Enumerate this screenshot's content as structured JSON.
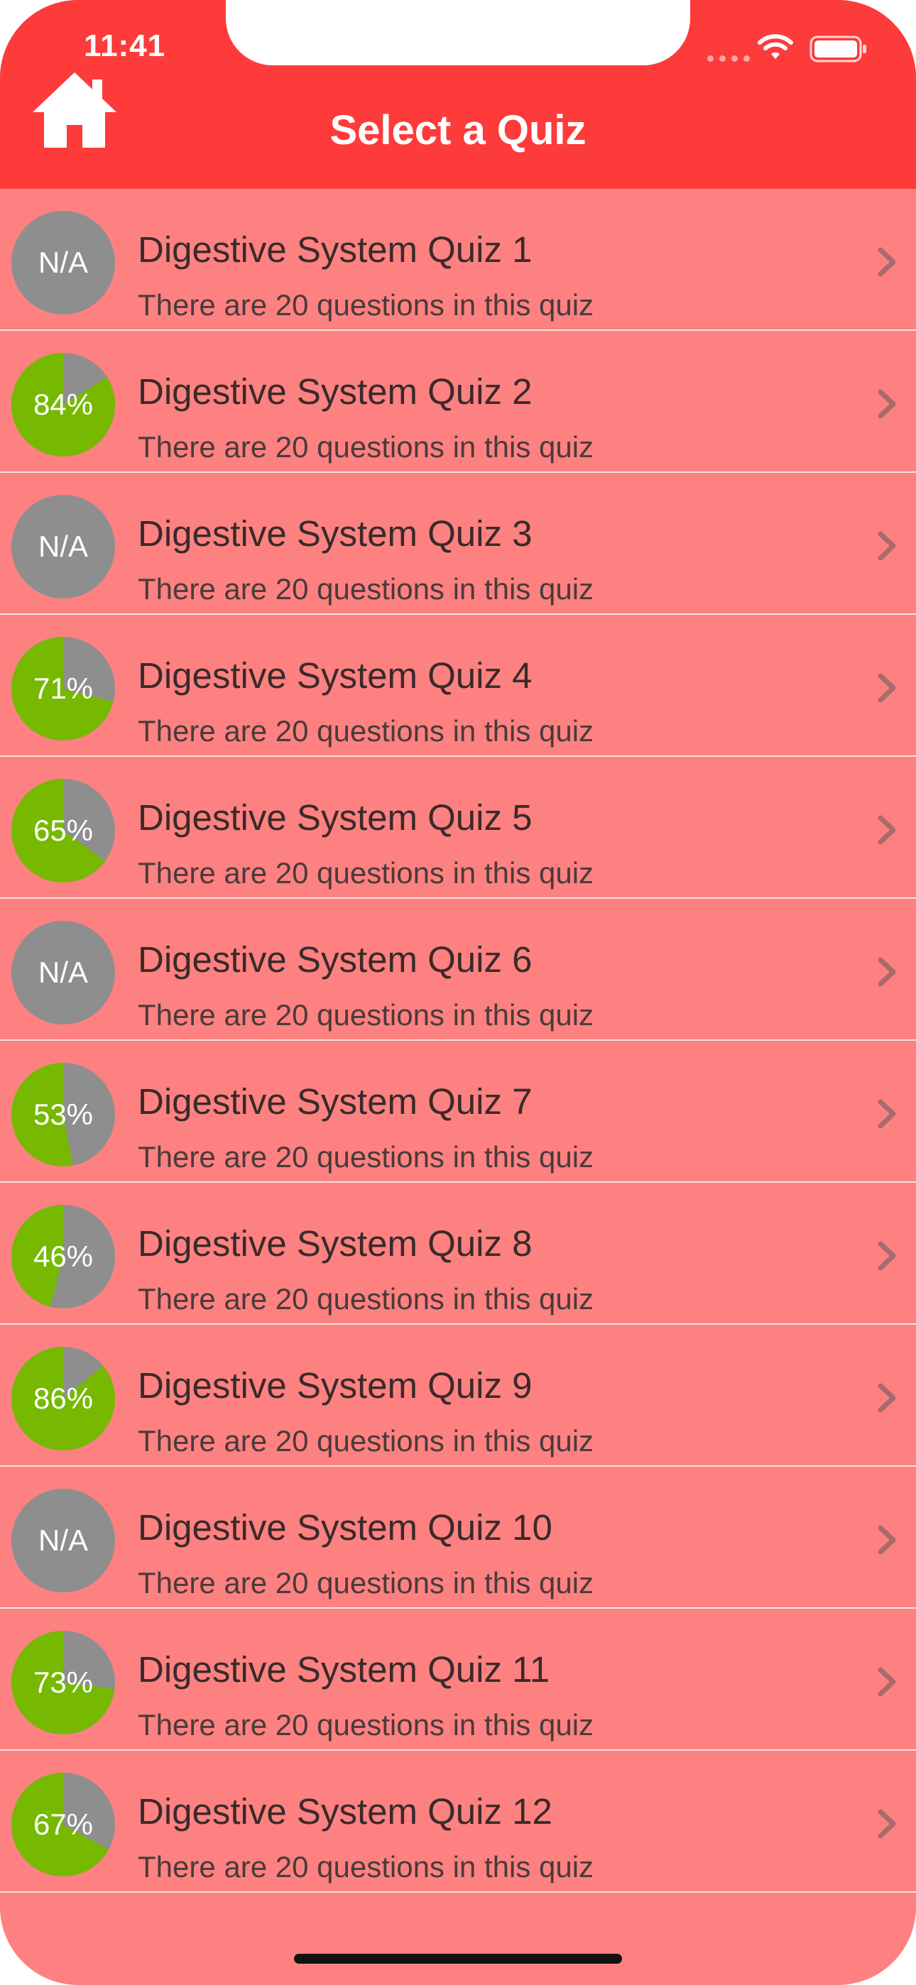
{
  "status_bar": {
    "time": "11:41"
  },
  "header": {
    "title": "Select a Quiz",
    "home_icon": "home-icon"
  },
  "colors": {
    "header_bg": "#fd3b3b",
    "list_bg": "#fd8181",
    "score_green": "#76b900",
    "score_gray": "#8e8e8e"
  },
  "quizzes": [
    {
      "title": "Digestive System Quiz 1",
      "subtitle": "There are 20 questions in this quiz",
      "score_label": "N/A",
      "score": null
    },
    {
      "title": "Digestive System Quiz 2",
      "subtitle": "There are 20 questions in this quiz",
      "score_label": "84%",
      "score": 84
    },
    {
      "title": "Digestive System Quiz 3",
      "subtitle": "There are 20 questions in this quiz",
      "score_label": "N/A",
      "score": null
    },
    {
      "title": "Digestive System Quiz 4",
      "subtitle": "There are 20 questions in this quiz",
      "score_label": "71%",
      "score": 71
    },
    {
      "title": "Digestive System Quiz 5",
      "subtitle": "There are 20 questions in this quiz",
      "score_label": "65%",
      "score": 65
    },
    {
      "title": "Digestive System Quiz 6",
      "subtitle": "There are 20 questions in this quiz",
      "score_label": "N/A",
      "score": null
    },
    {
      "title": "Digestive System Quiz 7",
      "subtitle": "There are 20 questions in this quiz",
      "score_label": "53%",
      "score": 53
    },
    {
      "title": "Digestive System Quiz 8",
      "subtitle": "There are 20 questions in this quiz",
      "score_label": "46%",
      "score": 46
    },
    {
      "title": "Digestive System Quiz 9",
      "subtitle": "There are 20 questions in this quiz",
      "score_label": "86%",
      "score": 86
    },
    {
      "title": "Digestive System Quiz 10",
      "subtitle": "There are 20 questions in this quiz",
      "score_label": "N/A",
      "score": null
    },
    {
      "title": "Digestive System Quiz 11",
      "subtitle": "There are 20 questions in this quiz",
      "score_label": "73%",
      "score": 73
    },
    {
      "title": "Digestive System Quiz 12",
      "subtitle": "There are 20 questions in this quiz",
      "score_label": "67%",
      "score": 67
    }
  ]
}
